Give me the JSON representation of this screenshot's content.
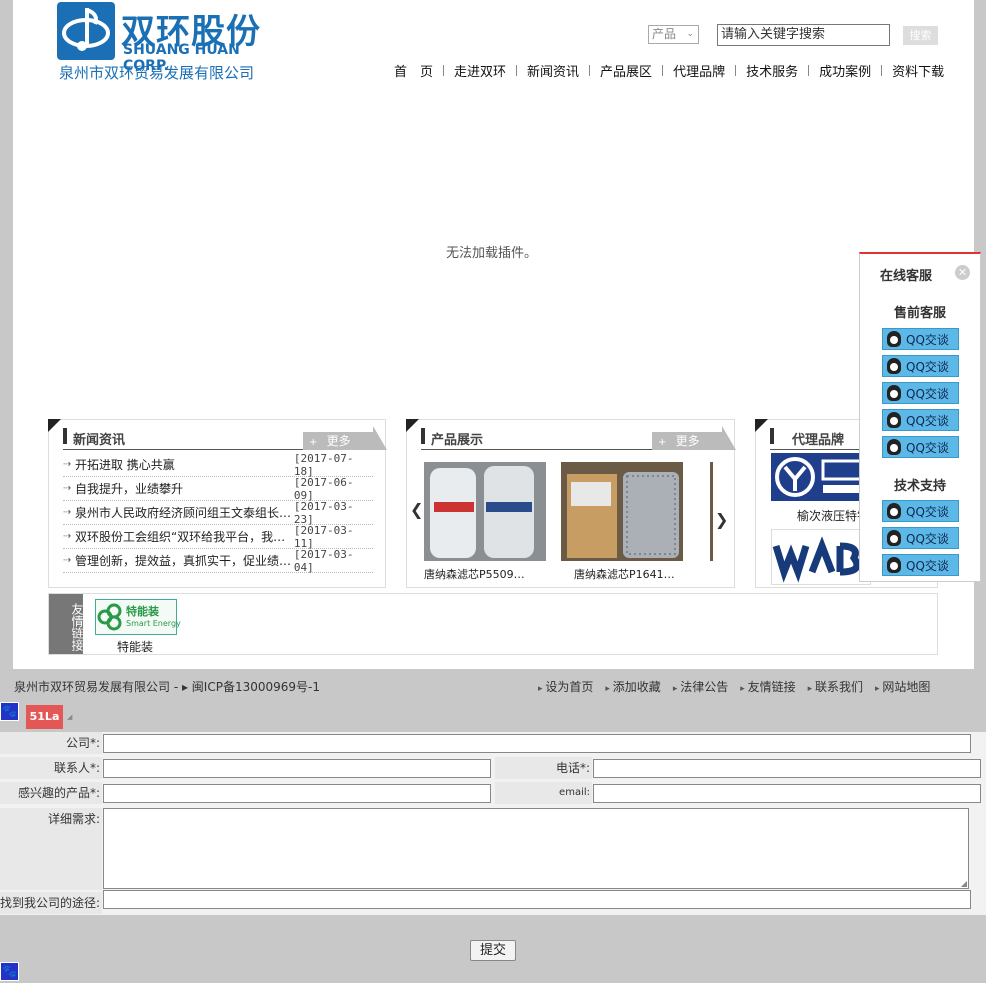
{
  "logo": {
    "cn": "双环股份",
    "en": "SHUANG HUAN CORP.",
    "company": "泉州市双环贸易发展有限公司"
  },
  "search": {
    "category": "产品",
    "placeholder": "请输入关键字搜索",
    "button": "搜索"
  },
  "nav": [
    "首　页",
    "走进双环",
    "新闻资讯",
    "产品展区",
    "代理品牌",
    "技术服务",
    "成功案例",
    "资料下载"
  ],
  "plugin_message": "无法加载插件。",
  "news": {
    "title": "新闻资讯",
    "more": "更多",
    "items": [
      {
        "title": "开拓进取 携心共赢",
        "date": "[2017-07-18]"
      },
      {
        "title": "自我提升，业绩攀升",
        "date": "[2017-06-09]"
      },
      {
        "title": "泉州市人民政府经济顾问组王文泰组长…",
        "date": "[2017-03-23]"
      },
      {
        "title": "双环股份工会组织“双环给我平台，我…",
        "date": "[2017-03-11]"
      },
      {
        "title": "管理创新，提效益，真抓实干，促业绩…",
        "date": "[2017-03-04]"
      }
    ]
  },
  "products": {
    "title": "产品展示",
    "more": "更多",
    "items": [
      {
        "caption": "唐纳森滤芯P5509…"
      },
      {
        "caption": "唐纳森滤芯P1641…"
      }
    ]
  },
  "brands": {
    "title": "代理品牌",
    "items": [
      {
        "caption": "榆次液压特钅"
      },
      {
        "caption": ""
      }
    ]
  },
  "friends": {
    "tag": "友情链接",
    "items": [
      {
        "name": "特能装",
        "logo_text": "特能装",
        "logo_sub": "Smart Energy"
      }
    ]
  },
  "footer": {
    "copyright": "泉州市双环贸易发展有限公司 - ▸ 闽ICP备13000969号-1",
    "links": [
      "设为首页",
      "添加收藏",
      "法律公告",
      "友情链接",
      "联系我们",
      "网站地图"
    ]
  },
  "badge": "51La",
  "form": {
    "company_label": "公司*:",
    "contact_label": "联系人*:",
    "phone_label": "电话*:",
    "product_label": "感兴趣的产品*:",
    "email_label": "email:",
    "detail_label": "详细需求:",
    "source_label": "找到我公司的途径:",
    "submit": "提交"
  },
  "service": {
    "title": "在线客服",
    "presale": "售前客服",
    "tech": "技术支持",
    "qq_label": "QQ交谈",
    "presale_count": 5,
    "tech_count": 3
  },
  "colors": {
    "brand": "#1a6fb5",
    "qq": "#5cb8e6",
    "badge": "#e45757",
    "service_border": "#dd3333"
  }
}
